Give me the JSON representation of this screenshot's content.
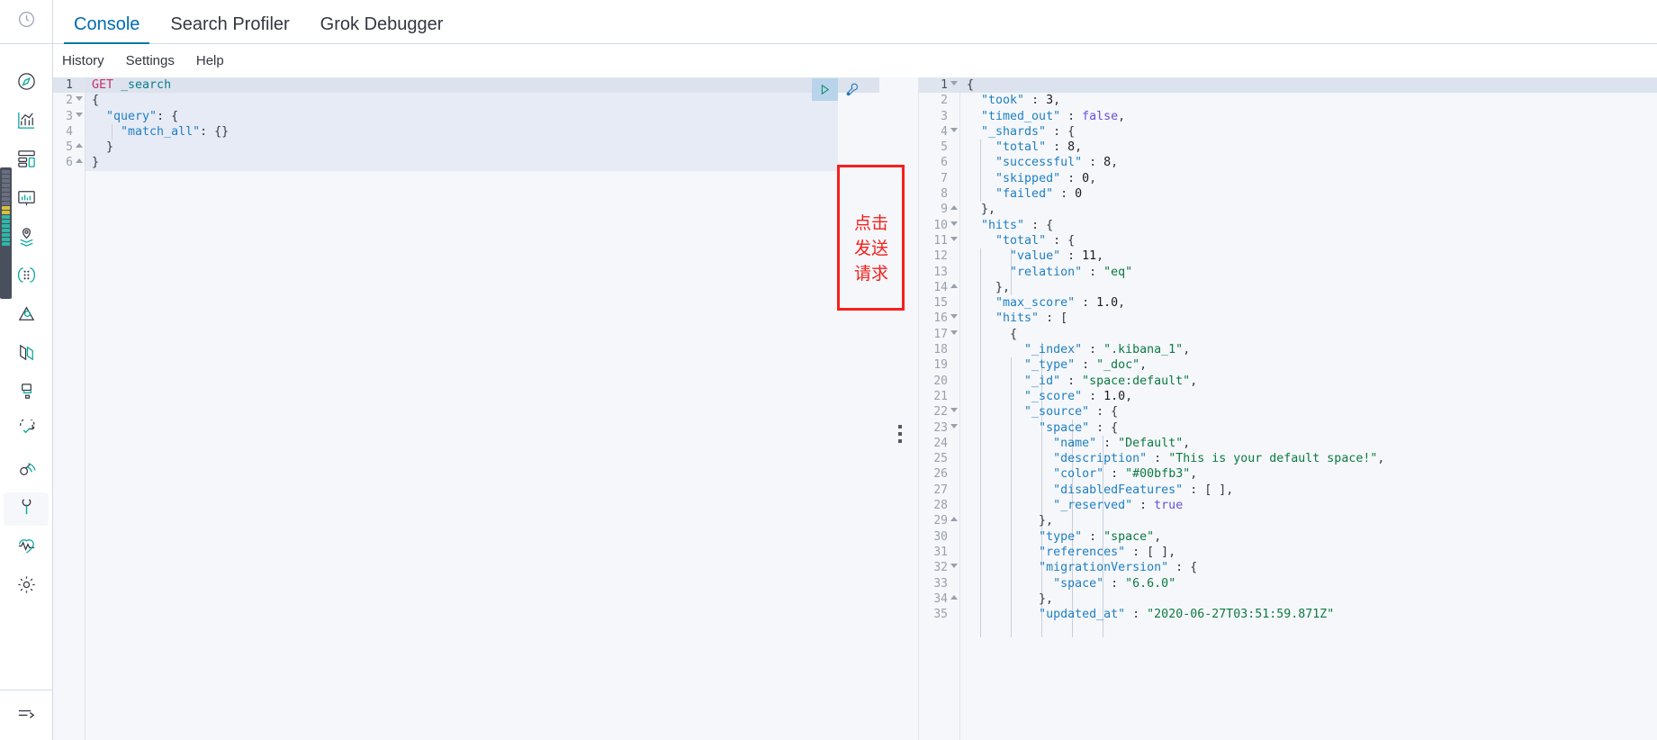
{
  "rail": {
    "top_item": {
      "name": "recently-viewed",
      "icon": "clock-icon",
      "label": "Recently viewed"
    },
    "items": [
      {
        "icon": "compass-icon",
        "label": "Discover"
      },
      {
        "icon": "visualize-icon",
        "label": "Visualize"
      },
      {
        "icon": "dashboard-icon",
        "label": "Dashboard"
      },
      {
        "icon": "canvas-icon",
        "label": "Canvas"
      },
      {
        "icon": "maps-icon",
        "label": "Maps"
      },
      {
        "icon": "ml-icon",
        "label": "Machine Learning"
      },
      {
        "icon": "infrastructure-icon",
        "label": "Infrastructure"
      },
      {
        "icon": "logs-icon",
        "label": "Logs"
      },
      {
        "icon": "apm-icon",
        "label": "APM"
      },
      {
        "icon": "uptime-icon",
        "label": "Uptime"
      },
      {
        "icon": "siem-icon",
        "label": "SIEM"
      },
      {
        "icon": "wrench-icon",
        "label": "Dev Tools",
        "active": true
      },
      {
        "icon": "monitoring-icon",
        "label": "Monitoring"
      },
      {
        "icon": "gear-icon",
        "label": "Management"
      }
    ],
    "bottom_item": {
      "icon": "collapse-arrow-icon",
      "label": "Collapse"
    }
  },
  "tabs": [
    {
      "label": "Console",
      "active": true
    },
    {
      "label": "Search Profiler",
      "active": false
    },
    {
      "label": "Grok Debugger",
      "active": false
    }
  ],
  "submenu": [
    {
      "label": "History"
    },
    {
      "label": "Settings"
    },
    {
      "label": "Help"
    }
  ],
  "editor": {
    "lines": [
      {
        "n": "1",
        "fold": "",
        "highlight": true,
        "tokens": [
          {
            "t": "GET ",
            "c": "k-method"
          },
          {
            "t": "_search",
            "c": "k-url"
          }
        ]
      },
      {
        "n": "2",
        "fold": "down",
        "highlight": false,
        "tokens": [
          {
            "t": "{",
            "c": "k-punct"
          }
        ]
      },
      {
        "n": "3",
        "fold": "down",
        "highlight": false,
        "tokens": [
          {
            "t": "  ",
            "c": "k-punct"
          },
          {
            "t": "\"query\"",
            "c": "k-key"
          },
          {
            "t": ": {",
            "c": "k-punct"
          }
        ]
      },
      {
        "n": "4",
        "fold": "",
        "highlight": false,
        "tokens": [
          {
            "t": "    ",
            "c": "k-punct"
          },
          {
            "t": "\"match_all\"",
            "c": "k-key"
          },
          {
            "t": ": {}",
            "c": "k-punct"
          }
        ]
      },
      {
        "n": "5",
        "fold": "up",
        "highlight": false,
        "tokens": [
          {
            "t": "  }",
            "c": "k-punct"
          }
        ]
      },
      {
        "n": "6",
        "fold": "up",
        "highlight": false,
        "tokens": [
          {
            "t": "}",
            "c": "k-punct"
          }
        ]
      }
    ],
    "actions": {
      "play": {
        "label": "Click to send request",
        "icon": "play-triangle-icon"
      },
      "wrench": {
        "label": "Open documentation / auto indent",
        "icon": "wrench-icon"
      }
    }
  },
  "annotation": {
    "text_lines": [
      "点击",
      "发送",
      "请求"
    ],
    "color": "#f4211e"
  },
  "response": {
    "lines": [
      {
        "n": "1",
        "fold": "down",
        "highlight": true,
        "tokens": [
          {
            "t": "{",
            "c": "k-punct"
          }
        ]
      },
      {
        "n": "2",
        "fold": "",
        "tokens": [
          {
            "t": "  ",
            "c": "k-punct"
          },
          {
            "t": "\"took\"",
            "c": "k-key"
          },
          {
            "t": " : ",
            "c": "k-punct"
          },
          {
            "t": "3",
            "c": "k-num"
          },
          {
            "t": ",",
            "c": "k-punct"
          }
        ]
      },
      {
        "n": "3",
        "fold": "",
        "tokens": [
          {
            "t": "  ",
            "c": "k-punct"
          },
          {
            "t": "\"timed_out\"",
            "c": "k-key"
          },
          {
            "t": " : ",
            "c": "k-punct"
          },
          {
            "t": "false",
            "c": "k-bool"
          },
          {
            "t": ",",
            "c": "k-punct"
          }
        ]
      },
      {
        "n": "4",
        "fold": "down",
        "tokens": [
          {
            "t": "  ",
            "c": "k-punct"
          },
          {
            "t": "\"_shards\"",
            "c": "k-key"
          },
          {
            "t": " : {",
            "c": "k-punct"
          }
        ]
      },
      {
        "n": "5",
        "fold": "",
        "tokens": [
          {
            "t": "    ",
            "c": "k-punct"
          },
          {
            "t": "\"total\"",
            "c": "k-key"
          },
          {
            "t": " : ",
            "c": "k-punct"
          },
          {
            "t": "8",
            "c": "k-num"
          },
          {
            "t": ",",
            "c": "k-punct"
          }
        ]
      },
      {
        "n": "6",
        "fold": "",
        "tokens": [
          {
            "t": "    ",
            "c": "k-punct"
          },
          {
            "t": "\"successful\"",
            "c": "k-key"
          },
          {
            "t": " : ",
            "c": "k-punct"
          },
          {
            "t": "8",
            "c": "k-num"
          },
          {
            "t": ",",
            "c": "k-punct"
          }
        ]
      },
      {
        "n": "7",
        "fold": "",
        "tokens": [
          {
            "t": "    ",
            "c": "k-punct"
          },
          {
            "t": "\"skipped\"",
            "c": "k-key"
          },
          {
            "t": " : ",
            "c": "k-punct"
          },
          {
            "t": "0",
            "c": "k-num"
          },
          {
            "t": ",",
            "c": "k-punct"
          }
        ]
      },
      {
        "n": "8",
        "fold": "",
        "tokens": [
          {
            "t": "    ",
            "c": "k-punct"
          },
          {
            "t": "\"failed\"",
            "c": "k-key"
          },
          {
            "t": " : ",
            "c": "k-punct"
          },
          {
            "t": "0",
            "c": "k-num"
          }
        ]
      },
      {
        "n": "9",
        "fold": "up",
        "tokens": [
          {
            "t": "  },",
            "c": "k-punct"
          }
        ]
      },
      {
        "n": "10",
        "fold": "down",
        "tokens": [
          {
            "t": "  ",
            "c": "k-punct"
          },
          {
            "t": "\"hits\"",
            "c": "k-key"
          },
          {
            "t": " : {",
            "c": "k-punct"
          }
        ]
      },
      {
        "n": "11",
        "fold": "down",
        "tokens": [
          {
            "t": "    ",
            "c": "k-punct"
          },
          {
            "t": "\"total\"",
            "c": "k-key"
          },
          {
            "t": " : {",
            "c": "k-punct"
          }
        ]
      },
      {
        "n": "12",
        "fold": "",
        "tokens": [
          {
            "t": "      ",
            "c": "k-punct"
          },
          {
            "t": "\"value\"",
            "c": "k-key"
          },
          {
            "t": " : ",
            "c": "k-punct"
          },
          {
            "t": "11",
            "c": "k-num"
          },
          {
            "t": ",",
            "c": "k-punct"
          }
        ]
      },
      {
        "n": "13",
        "fold": "",
        "tokens": [
          {
            "t": "      ",
            "c": "k-punct"
          },
          {
            "t": "\"relation\"",
            "c": "k-key"
          },
          {
            "t": " : ",
            "c": "k-punct"
          },
          {
            "t": "\"eq\"",
            "c": "k-str"
          }
        ]
      },
      {
        "n": "14",
        "fold": "up",
        "tokens": [
          {
            "t": "    },",
            "c": "k-punct"
          }
        ]
      },
      {
        "n": "15",
        "fold": "",
        "tokens": [
          {
            "t": "    ",
            "c": "k-punct"
          },
          {
            "t": "\"max_score\"",
            "c": "k-key"
          },
          {
            "t": " : ",
            "c": "k-punct"
          },
          {
            "t": "1.0",
            "c": "k-num"
          },
          {
            "t": ",",
            "c": "k-punct"
          }
        ]
      },
      {
        "n": "16",
        "fold": "down",
        "tokens": [
          {
            "t": "    ",
            "c": "k-punct"
          },
          {
            "t": "\"hits\"",
            "c": "k-key"
          },
          {
            "t": " : [",
            "c": "k-punct"
          }
        ]
      },
      {
        "n": "17",
        "fold": "down",
        "tokens": [
          {
            "t": "      {",
            "c": "k-punct"
          }
        ]
      },
      {
        "n": "18",
        "fold": "",
        "tokens": [
          {
            "t": "        ",
            "c": "k-punct"
          },
          {
            "t": "\"_index\"",
            "c": "k-key"
          },
          {
            "t": " : ",
            "c": "k-punct"
          },
          {
            "t": "\".kibana_1\"",
            "c": "k-str"
          },
          {
            "t": ",",
            "c": "k-punct"
          }
        ]
      },
      {
        "n": "19",
        "fold": "",
        "tokens": [
          {
            "t": "        ",
            "c": "k-punct"
          },
          {
            "t": "\"_type\"",
            "c": "k-key"
          },
          {
            "t": " : ",
            "c": "k-punct"
          },
          {
            "t": "\"_doc\"",
            "c": "k-str"
          },
          {
            "t": ",",
            "c": "k-punct"
          }
        ]
      },
      {
        "n": "20",
        "fold": "",
        "tokens": [
          {
            "t": "        ",
            "c": "k-punct"
          },
          {
            "t": "\"_id\"",
            "c": "k-key"
          },
          {
            "t": " : ",
            "c": "k-punct"
          },
          {
            "t": "\"space:default\"",
            "c": "k-str"
          },
          {
            "t": ",",
            "c": "k-punct"
          }
        ]
      },
      {
        "n": "21",
        "fold": "",
        "tokens": [
          {
            "t": "        ",
            "c": "k-punct"
          },
          {
            "t": "\"_score\"",
            "c": "k-key"
          },
          {
            "t": " : ",
            "c": "k-punct"
          },
          {
            "t": "1.0",
            "c": "k-num"
          },
          {
            "t": ",",
            "c": "k-punct"
          }
        ]
      },
      {
        "n": "22",
        "fold": "down",
        "tokens": [
          {
            "t": "        ",
            "c": "k-punct"
          },
          {
            "t": "\"_source\"",
            "c": "k-key"
          },
          {
            "t": " : {",
            "c": "k-punct"
          }
        ]
      },
      {
        "n": "23",
        "fold": "down",
        "tokens": [
          {
            "t": "          ",
            "c": "k-punct"
          },
          {
            "t": "\"space\"",
            "c": "k-key"
          },
          {
            "t": " : {",
            "c": "k-punct"
          }
        ]
      },
      {
        "n": "24",
        "fold": "",
        "tokens": [
          {
            "t": "            ",
            "c": "k-punct"
          },
          {
            "t": "\"name\"",
            "c": "k-key"
          },
          {
            "t": " : ",
            "c": "k-punct"
          },
          {
            "t": "\"Default\"",
            "c": "k-str"
          },
          {
            "t": ",",
            "c": "k-punct"
          }
        ]
      },
      {
        "n": "25",
        "fold": "",
        "tokens": [
          {
            "t": "            ",
            "c": "k-punct"
          },
          {
            "t": "\"description\"",
            "c": "k-key"
          },
          {
            "t": " : ",
            "c": "k-punct"
          },
          {
            "t": "\"This is your default space!\"",
            "c": "k-str"
          },
          {
            "t": ",",
            "c": "k-punct"
          }
        ]
      },
      {
        "n": "26",
        "fold": "",
        "tokens": [
          {
            "t": "            ",
            "c": "k-punct"
          },
          {
            "t": "\"color\"",
            "c": "k-key"
          },
          {
            "t": " : ",
            "c": "k-punct"
          },
          {
            "t": "\"#00bfb3\"",
            "c": "k-str"
          },
          {
            "t": ",",
            "c": "k-punct"
          }
        ]
      },
      {
        "n": "27",
        "fold": "",
        "tokens": [
          {
            "t": "            ",
            "c": "k-punct"
          },
          {
            "t": "\"disabledFeatures\"",
            "c": "k-key"
          },
          {
            "t": " : [ ],",
            "c": "k-punct"
          }
        ]
      },
      {
        "n": "28",
        "fold": "",
        "tokens": [
          {
            "t": "            ",
            "c": "k-punct"
          },
          {
            "t": "\"_reserved\"",
            "c": "k-key"
          },
          {
            "t": " : ",
            "c": "k-punct"
          },
          {
            "t": "true",
            "c": "k-bool"
          }
        ]
      },
      {
        "n": "29",
        "fold": "up",
        "tokens": [
          {
            "t": "          },",
            "c": "k-punct"
          }
        ]
      },
      {
        "n": "30",
        "fold": "",
        "tokens": [
          {
            "t": "          ",
            "c": "k-punct"
          },
          {
            "t": "\"type\"",
            "c": "k-key"
          },
          {
            "t": " : ",
            "c": "k-punct"
          },
          {
            "t": "\"space\"",
            "c": "k-str"
          },
          {
            "t": ",",
            "c": "k-punct"
          }
        ]
      },
      {
        "n": "31",
        "fold": "",
        "tokens": [
          {
            "t": "          ",
            "c": "k-punct"
          },
          {
            "t": "\"references\"",
            "c": "k-key"
          },
          {
            "t": " : [ ],",
            "c": "k-punct"
          }
        ]
      },
      {
        "n": "32",
        "fold": "down",
        "tokens": [
          {
            "t": "          ",
            "c": "k-punct"
          },
          {
            "t": "\"migrationVersion\"",
            "c": "k-key"
          },
          {
            "t": " : {",
            "c": "k-punct"
          }
        ]
      },
      {
        "n": "33",
        "fold": "",
        "tokens": [
          {
            "t": "            ",
            "c": "k-punct"
          },
          {
            "t": "\"space\"",
            "c": "k-key"
          },
          {
            "t": " : ",
            "c": "k-punct"
          },
          {
            "t": "\"6.6.0\"",
            "c": "k-str"
          }
        ]
      },
      {
        "n": "34",
        "fold": "up",
        "tokens": [
          {
            "t": "          },",
            "c": "k-punct"
          }
        ]
      },
      {
        "n": "35",
        "fold": "",
        "tokens": [
          {
            "t": "          ",
            "c": "k-punct"
          },
          {
            "t": "\"updated_at\"",
            "c": "k-key"
          },
          {
            "t": " : ",
            "c": "k-punct"
          },
          {
            "t": "\"2020-06-27T03:51:59.871Z\"",
            "c": "k-str"
          }
        ]
      }
    ]
  },
  "colors": {
    "accent": "#0079a5",
    "border": "#d3dae6",
    "bg": "#f5f7fa",
    "annotation_red": "#f4211e",
    "selection": "#e7ebf5",
    "space_color": "#00bfb3"
  }
}
